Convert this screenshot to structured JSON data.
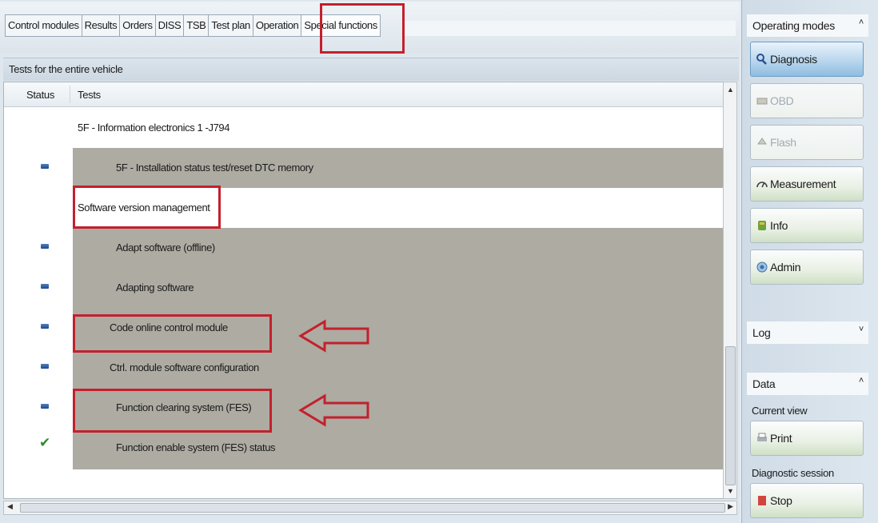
{
  "tabs": [
    {
      "label": "Control modules"
    },
    {
      "label": "Results"
    },
    {
      "label": "Orders"
    },
    {
      "label": "DISS"
    },
    {
      "label": "TSB"
    },
    {
      "label": "Test plan"
    },
    {
      "label": "Operation"
    },
    {
      "label": "Special functions"
    }
  ],
  "section_title": "Tests for the entire vehicle",
  "grid": {
    "col_status": "Status",
    "col_tests": "Tests",
    "rows": [
      {
        "text": "5F - Information electronics 1 -J794",
        "status": "none"
      },
      {
        "text": "5F - Installation status test/reset DTC memory",
        "status": "pending"
      },
      {
        "text": "Software version management",
        "status": "none"
      },
      {
        "text": "Adapt software (offline)",
        "status": "pending"
      },
      {
        "text": "Adapting software",
        "status": "pending"
      },
      {
        "text": "Code online control module",
        "status": "pending"
      },
      {
        "text": "Ctrl. module software configuration",
        "status": "pending"
      },
      {
        "text": "Function clearing system (FES)",
        "status": "pending"
      },
      {
        "text": "Function enable system (FES) status",
        "status": "done"
      }
    ]
  },
  "sidebar": {
    "operating_modes": {
      "title": "Operating modes",
      "buttons": [
        {
          "label": "Diagnosis",
          "icon": "diagnosis-icon",
          "state": "active"
        },
        {
          "label": "OBD",
          "icon": "obd-icon",
          "state": "disabled"
        },
        {
          "label": "Flash",
          "icon": "flash-icon",
          "state": "disabled"
        },
        {
          "label": "Measurement",
          "icon": "measurement-icon",
          "state": "normal"
        },
        {
          "label": "Info",
          "icon": "info-icon",
          "state": "normal"
        },
        {
          "label": "Admin",
          "icon": "admin-icon",
          "state": "normal"
        }
      ]
    },
    "log": {
      "title": "Log"
    },
    "data": {
      "title": "Data",
      "current_view_label": "Current view",
      "print_label": "Print",
      "diagnostic_session_label": "Diagnostic session",
      "stop_label": "Stop"
    }
  },
  "colors": {
    "highlight": "#c4202c",
    "grey_band": "#adaba2",
    "status_pending": "#2f5fa5",
    "status_done": "#2f8a2f"
  }
}
